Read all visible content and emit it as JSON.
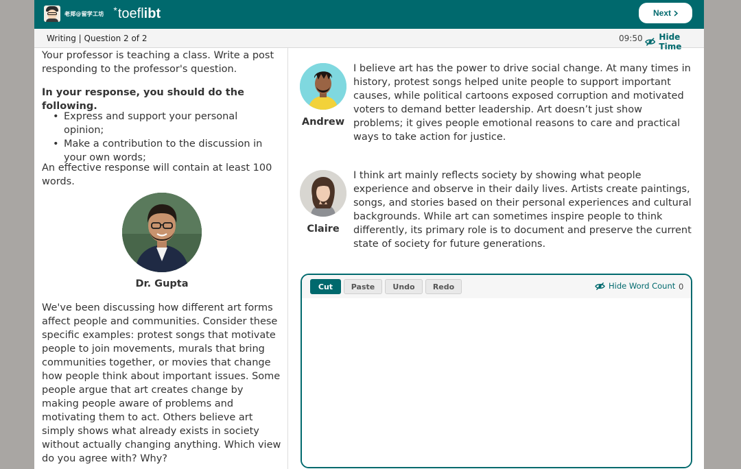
{
  "header": {
    "brand_name": "老郑@留学工坊",
    "logo_star": "*",
    "logo_toefl": "toefl",
    "logo_ibt": " ibt",
    "next_label": "Next",
    "next_icon": "chevron-right-icon"
  },
  "subheader": {
    "section_label": "Writing | Question 2 of 2",
    "timer": "09:50",
    "hide_time_label": "Hide Time",
    "hide_time_icon": "eye-off-icon"
  },
  "prompt": {
    "intro": "Your professor is teaching a class. Write a post responding to the professor's question.",
    "task_heading": "In your response, you should do the following.",
    "tasks": [
      "Express and support your personal opinion;",
      "Make a contribution to the discussion in your own words;"
    ],
    "requirement": "An effective response will contain at least 100 words.",
    "professor_name": "Dr. Gupta",
    "professor_post": "We've been discussing how different art forms affect people and communities. Consider these specific examples: protest songs that motivate people to join movements, murals that bring communities together, or movies that change how people think about important issues. Some people argue that art creates change by making people aware of problems and motivating them to act. Others believe art simply shows what already exists in society without actually changing anything. Which view do you agree with? Why?"
  },
  "discussion": {
    "posts": [
      {
        "name": "Andrew",
        "text": "I believe art has the power to drive social change. At many times in history, protest songs helped unite people to support important causes, while political cartoons exposed corruption and motivated voters to demand better leadership. Art doesn’t just show problems; it gives people emotional reasons to care and practical ways to take action for justice."
      },
      {
        "name": "Claire",
        "text": "I think art mainly reflects society by showing what people experience and observe in their daily lives. Artists create paintings, songs, and stories based on their personal experiences and cultural backgrounds. While art can sometimes inspire people to think differently, its primary role is to document and preserve the current state of society for future generations."
      }
    ]
  },
  "editor": {
    "buttons": {
      "cut": "Cut",
      "paste": "Paste",
      "undo": "Undo",
      "redo": "Redo"
    },
    "hide_word_count_label": "Hide Word Count",
    "word_count": "0",
    "value": ""
  },
  "colors": {
    "accent": "#00696d",
    "backdrop": "#a9a6a3"
  }
}
